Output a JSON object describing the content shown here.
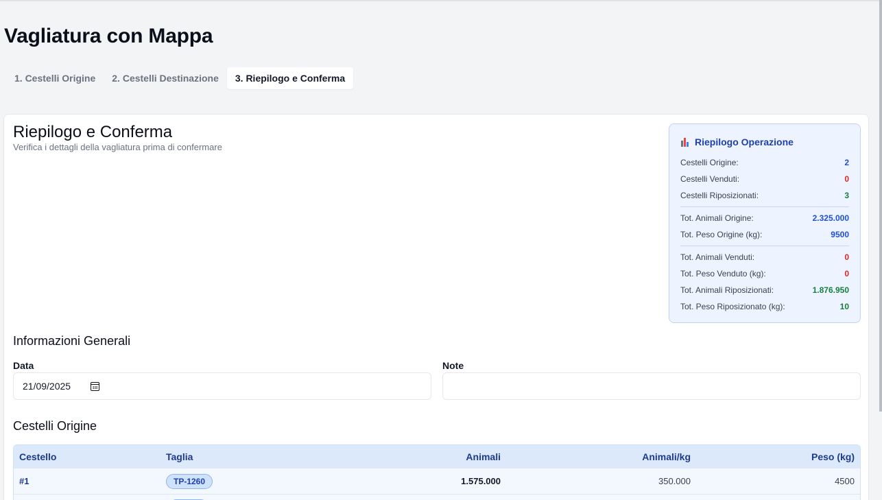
{
  "page": {
    "title": "Vagliatura con Mappa"
  },
  "tabs": [
    {
      "label": "1. Cestelli Origine",
      "active": false
    },
    {
      "label": "2. Cestelli Destinazione",
      "active": false
    },
    {
      "label": "3. Riepilogo e Conferma",
      "active": true
    }
  ],
  "card": {
    "title": "Riepilogo e Conferma",
    "subtitle": "Verifica i dettagli della vagliatura prima di confermare"
  },
  "summary": {
    "icon": "bar-chart-icon",
    "title": "Riepilogo Operazione",
    "rows": [
      {
        "label": "Cestelli Origine:",
        "value": "2",
        "color": "#1d4ed8"
      },
      {
        "label": "Cestelli Venduti:",
        "value": "0",
        "color": "#dc2626"
      },
      {
        "label": "Cestelli Riposizionati:",
        "value": "3",
        "color": "#15803d"
      },
      {
        "label": "Tot. Animali Origine:",
        "value": "2.325.000",
        "color": "#1d4ed8"
      },
      {
        "label": "Tot. Peso Origine (kg):",
        "value": "9500",
        "color": "#1d4ed8"
      },
      {
        "label": "Tot. Animali Venduti:",
        "value": "0",
        "color": "#dc2626"
      },
      {
        "label": "Tot. Peso Venduto (kg):",
        "value": "0",
        "color": "#dc2626"
      },
      {
        "label": "Tot. Animali Riposizionati:",
        "value": "1.876.950",
        "color": "#15803d"
      },
      {
        "label": "Tot. Peso Riposizionato (kg):",
        "value": "10",
        "color": "#15803d"
      }
    ]
  },
  "general": {
    "title": "Informazioni Generali",
    "date_label": "Data",
    "date_value": "21/09/2025",
    "notes_label": "Note",
    "notes_value": ""
  },
  "origin_table": {
    "title": "Cestelli Origine",
    "columns": [
      "Cestello",
      "Taglia",
      "Animali",
      "Animali/kg",
      "Peso (kg)"
    ],
    "rows": [
      {
        "cestello": "#1",
        "taglia": "TP-1260",
        "animali": "1.575.000",
        "animali_kg": "350.000",
        "peso": "4500"
      }
    ]
  }
}
